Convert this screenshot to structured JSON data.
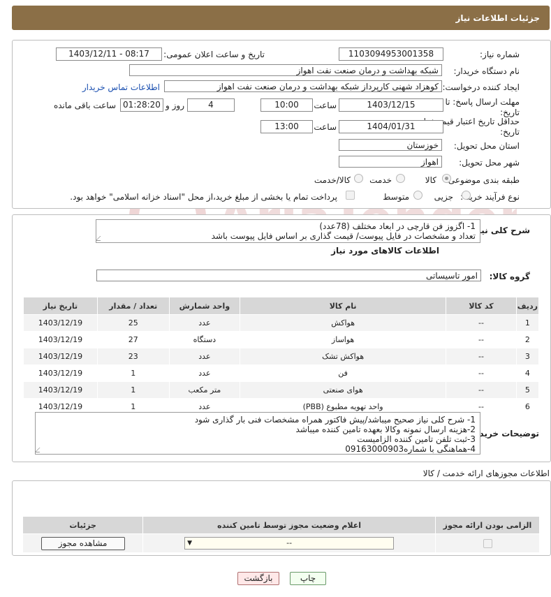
{
  "header": {
    "title": "جزئیات اطلاعات نیاز"
  },
  "need_number": {
    "label": "شماره نیاز:",
    "value": "1103094953001358"
  },
  "announce_datetime": {
    "label": "تاریخ و ساعت اعلان عمومی:",
    "value": "1403/12/11 - 08:17"
  },
  "buyer_org": {
    "label": "نام دستگاه خریدار:",
    "value": "شبکه بهداشت و درمان صنعت نفت اهواز"
  },
  "requester": {
    "label": "ایجاد کننده درخواست:",
    "value": "کوهزاد شهنی کارپرداز شبکه بهداشت و درمان صنعت نفت اهواز",
    "contact_link": "اطلاعات تماس خریدار"
  },
  "reply_deadline": {
    "label": "مهلت ارسال پاسخ: تا تاریخ:",
    "date": "1403/12/15",
    "time_label": "ساعت",
    "time": "10:00",
    "days": "4",
    "days_label": "روز و",
    "remaining": "01:28:20",
    "remaining_label": "ساعت باقی مانده"
  },
  "price_validity": {
    "label": "حداقل تاریخ اعتبار قیمت: تا تاریخ:",
    "date": "1404/01/31",
    "time_label": "ساعت",
    "time": "13:00"
  },
  "province": {
    "label": "استان محل تحویل:",
    "value": "خوزستان"
  },
  "city": {
    "label": "شهر محل تحویل:",
    "value": "اهواز"
  },
  "category": {
    "label": "طبقه بندی موضوعی:",
    "options": [
      "کالا",
      "خدمت",
      "کالا/خدمت"
    ],
    "selected": "کالا"
  },
  "purchase_type": {
    "label": "نوع فرآیند خرید :",
    "options": [
      "جزیی",
      "متوسط"
    ],
    "payment_note": "پرداخت تمام یا بخشی از مبلغ خرید،از محل \"اسناد خزانه اسلامی\" خواهد بود."
  },
  "general_description": {
    "label": "شرح کلی نیاز:",
    "line1": "1- اگزوز فن قارچی در ابعاد مختلف (78عدد)",
    "line2": "تعداد و مشخصات در فایل پیوست/ قیمت گذاری بر اساس فایل پیوست باشد"
  },
  "goods_section": {
    "title": "اطلاعات کالاهای مورد نیاز",
    "group_label": "گروه کالا:",
    "group_value": "امور تاسیساتی"
  },
  "goods_table": {
    "headers": [
      "ردیف",
      "کد کالا",
      "نام کالا",
      "واحد شمارش",
      "تعداد / مقدار",
      "تاریخ نیاز"
    ],
    "rows": [
      [
        "1",
        "--",
        "هواکش",
        "عدد",
        "25",
        "1403/12/19"
      ],
      [
        "2",
        "--",
        "هواساز",
        "دستگاه",
        "27",
        "1403/12/19"
      ],
      [
        "3",
        "--",
        "هواکش تشک",
        "عدد",
        "23",
        "1403/12/19"
      ],
      [
        "4",
        "--",
        "فن",
        "عدد",
        "1",
        "1403/12/19"
      ],
      [
        "5",
        "--",
        "هوای صنعتی",
        "متر مکعب",
        "1",
        "1403/12/19"
      ],
      [
        "6",
        "--",
        "واحد تهویه مطبوع (PBB)",
        "عدد",
        "1",
        "1403/12/19"
      ]
    ]
  },
  "buyer_notes": {
    "label": "توضیحات خریدار:",
    "lines": [
      "1- شرح کلی نیاز صحیح میباشد/پیش فاکتور همراه مشخصات فنی بار گذاری شود",
      "2-هزینه ارسال نمونه وکالا بعهده تامین کننده میباشد",
      "3-ثبت تلفن تامین کننده الزامیست",
      "4-هماهنگی با شماره09163000903"
    ]
  },
  "permits": {
    "title": "اطلاعات مجوزهای ارائه خدمت / کالا",
    "headers": [
      "الزامی بودن ارائه مجوز",
      "اعلام وضعیت مجوز توسط تامین کننده",
      "جزئیات"
    ],
    "select_value": "--",
    "view_button": "مشاهده مجوز"
  },
  "footer": {
    "print": "چاپ",
    "back": "بازگشت"
  }
}
